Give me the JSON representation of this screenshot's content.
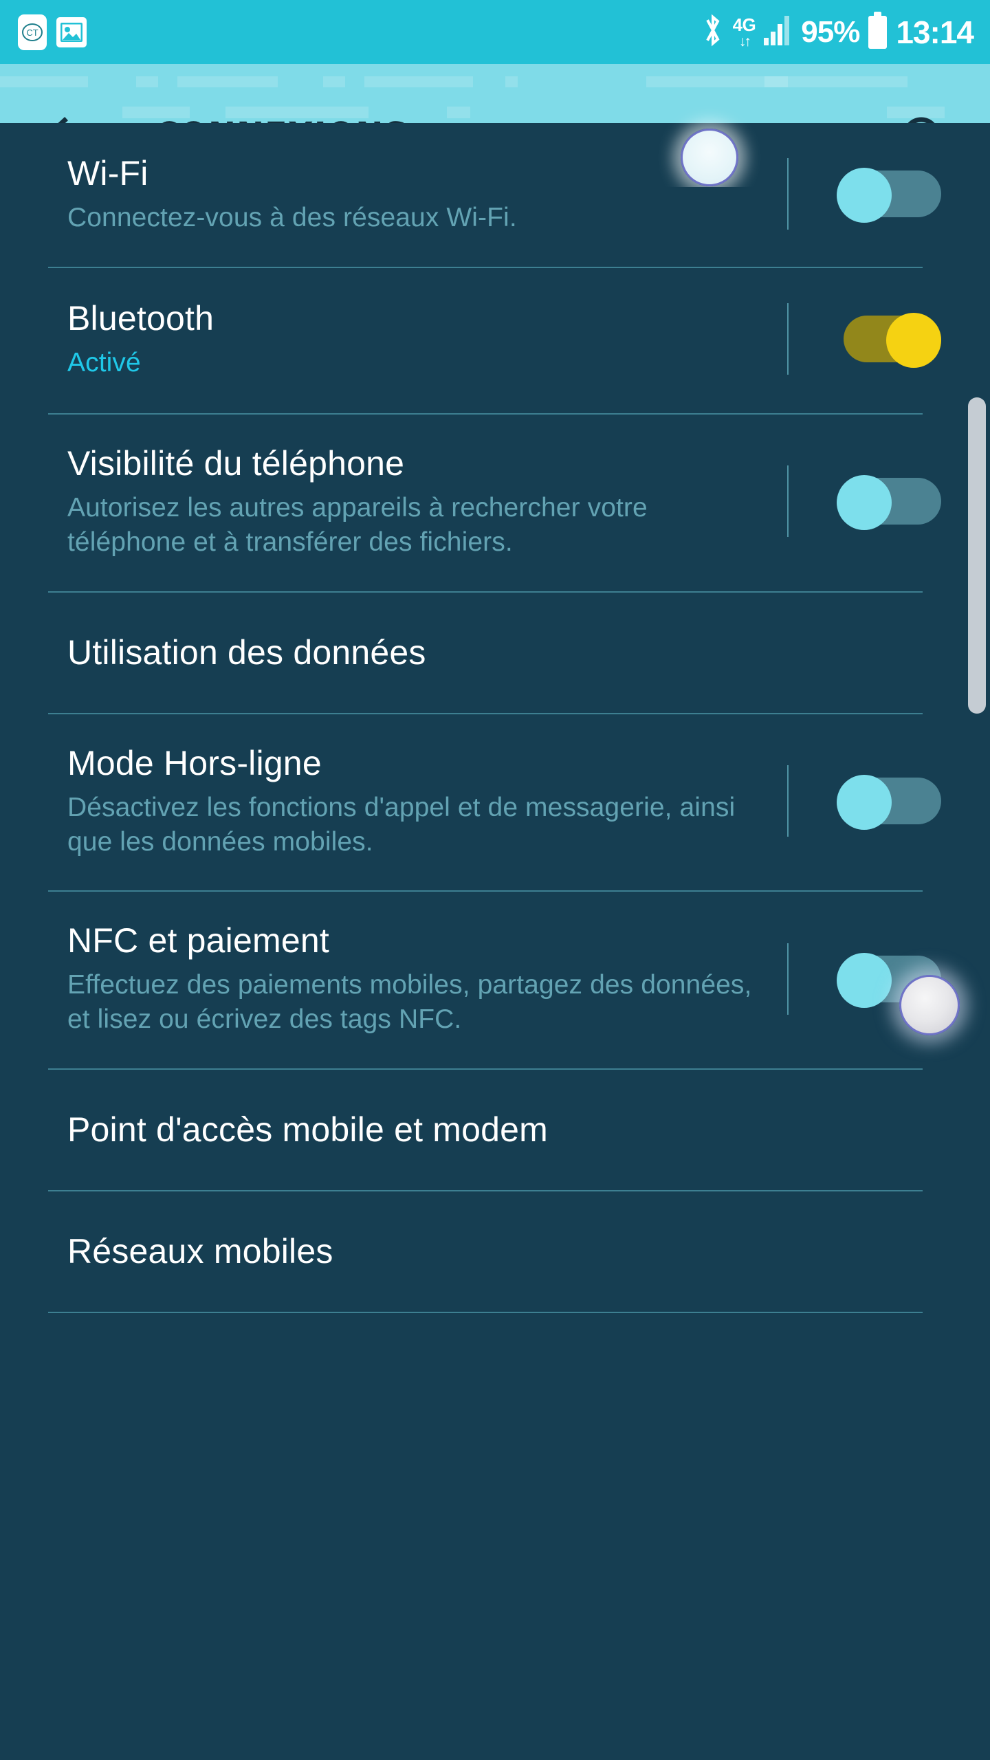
{
  "status_bar": {
    "background_color": "#22c1d6",
    "left_icons": [
      {
        "name": "ct-badge-icon",
        "label": "CT"
      },
      {
        "name": "image-icon",
        "label": "image"
      }
    ],
    "right_icons": [
      {
        "name": "bluetooth-icon",
        "label": "bluetooth"
      },
      {
        "name": "network-4g-icon",
        "label": "4G",
        "arrows": "↓↑"
      },
      {
        "name": "signal-bars-icon",
        "label": "signal"
      }
    ],
    "battery_percent": "95%",
    "clock": "13:14"
  },
  "header": {
    "background_color": "#7fdbe8",
    "title": "CONNEXIONS",
    "back_label": "Retour",
    "search_label": "Rechercher",
    "title_color": "#14303f"
  },
  "list": {
    "background_color": "#163e52",
    "title_color": "#ffffff",
    "subtitle_color": "#63a3b3",
    "accent_on_color": "#f5d212",
    "accent_off_color": "#7ddfec",
    "items": [
      {
        "name": "wifi",
        "title": "Wi-Fi",
        "subtitle": "Connectez-vous à des réseaux Wi-Fi.",
        "has_toggle": true,
        "toggle_state": "off"
      },
      {
        "name": "bluetooth",
        "title": "Bluetooth",
        "subtitle": "Activé",
        "subtitle_color": "#1fc8e8",
        "has_toggle": true,
        "toggle_state": "on"
      },
      {
        "name": "phone-visibility",
        "title": "Visibilité du téléphone",
        "subtitle": "Autorisez les autres appareils à rechercher votre téléphone et à transférer des fichiers.",
        "has_toggle": true,
        "toggle_state": "off"
      },
      {
        "name": "data-usage",
        "title": "Utilisation des données",
        "subtitle": "",
        "has_toggle": false
      },
      {
        "name": "airplane-mode",
        "title": "Mode Hors-ligne",
        "subtitle": "Désactivez les fonctions d'appel et de messagerie, ainsi que les données mobiles.",
        "has_toggle": true,
        "toggle_state": "off"
      },
      {
        "name": "nfc-payment",
        "title": "NFC et paiement",
        "subtitle": "Effectuez des paiements mobiles, partagez des données, et lisez ou écrivez des tags NFC.",
        "has_toggle": true,
        "toggle_state": "off"
      },
      {
        "name": "mobile-hotspot-tethering",
        "title": "Point d'accès mobile et modem",
        "subtitle": "",
        "has_toggle": false
      },
      {
        "name": "mobile-networks",
        "title": "Réseaux mobiles",
        "subtitle": "",
        "has_toggle": false
      }
    ]
  },
  "overlays": {
    "touch_indicator_ring_color": "#6f73c7",
    "scrollbar_color": "#c5ccd3"
  }
}
